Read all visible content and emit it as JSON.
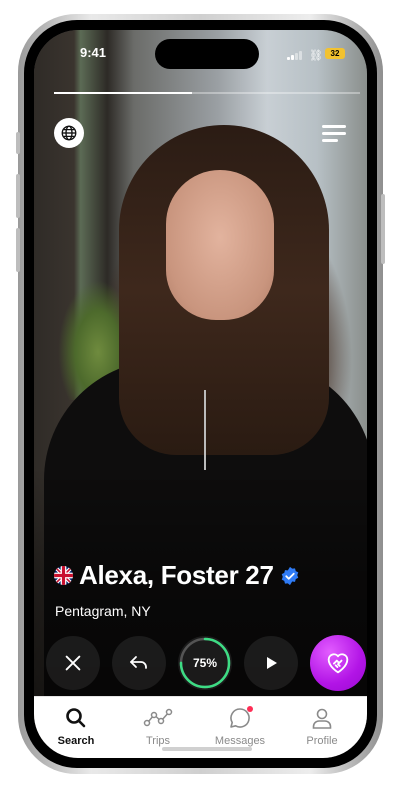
{
  "status_bar": {
    "time": "9:41",
    "battery": "32"
  },
  "profile": {
    "name": "Alexa, Foster 27",
    "location": "Pentagram, NY",
    "flag": "uk-flag-icon",
    "verified": true,
    "photo_progress": 0.45
  },
  "actions": {
    "skip": "close-icon",
    "undo": "undo-icon",
    "compatibility": "75%",
    "compatibility_value": 0.75,
    "play": "play-icon",
    "like": "heart-handshake-icon"
  },
  "tabs": [
    {
      "label": "Search",
      "icon": "search-icon",
      "active": true
    },
    {
      "label": "Trips",
      "icon": "trips-icon",
      "active": false
    },
    {
      "label": "Messages",
      "icon": "chat-bubble-icon",
      "active": false,
      "badge": true
    },
    {
      "label": "Profile",
      "icon": "profile-icon",
      "active": false
    }
  ],
  "colors": {
    "accent": "#b214e6",
    "ring": "#3ddc84",
    "verified": "#2f7bf5"
  }
}
